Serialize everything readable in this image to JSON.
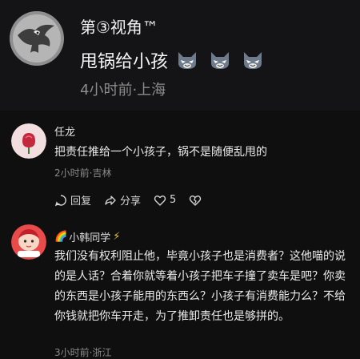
{
  "post": {
    "author": "第③视角™",
    "title": "甩锅给小孩",
    "emojis": [
      "cat-face-icon",
      "cat-face-icon",
      "cat-face-icon"
    ],
    "meta": "4小时前·上海"
  },
  "comments": [
    {
      "name": "任龙",
      "body": "把责任推给一个小孩子，锅不是随便乱甩的",
      "meta": "2小时前·吉林",
      "actions": {
        "reply": "回复",
        "share": "分享",
        "likes": "5"
      }
    },
    {
      "name_prefix": "🌈",
      "name": "小韩同学",
      "name_suffix": "⚡",
      "body": "我们没有权利阻止他，毕竟小孩子也是消费者？这他喵的说的是人话？合着你就等着小孩子把车子撞了卖车是吧？你卖的东西是小孩子能用的东西么？小孩子有消费能力么？不给你钱就把你车开走，为了推卸责任也是够拼的。",
      "meta": "3小时前·浙江"
    }
  ],
  "colors": {
    "background": "#0f0f10",
    "muted_text": "#8c8c8c",
    "accent_bolt": "#f3c33a"
  }
}
